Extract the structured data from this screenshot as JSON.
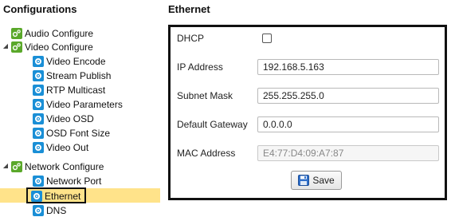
{
  "sidebar": {
    "title": "Configurations",
    "items": [
      {
        "label": "Audio Configure"
      },
      {
        "label": "Video Configure"
      },
      {
        "label": "Video Encode"
      },
      {
        "label": "Stream Publish"
      },
      {
        "label": "RTP Multicast"
      },
      {
        "label": "Video Parameters"
      },
      {
        "label": "Video OSD"
      },
      {
        "label": "OSD Font Size"
      },
      {
        "label": "Video Out"
      },
      {
        "label": "Network Configure"
      },
      {
        "label": "Network Port"
      },
      {
        "label": "Ethernet"
      },
      {
        "label": "DNS"
      }
    ]
  },
  "main": {
    "title": "Ethernet",
    "dhcp_label": "DHCP",
    "dhcp_checked": false,
    "ip_label": "IP Address",
    "ip_value": "192.168.5.163",
    "mask_label": "Subnet Mask",
    "mask_value": "255.255.255.0",
    "gateway_label": "Default Gateway",
    "gateway_value": "0.0.0.0",
    "mac_label": "MAC Address",
    "mac_value": "E4:77:D4:09:A7:87",
    "save_label": "Save"
  },
  "colors": {
    "selected_bg": "#ffe38a",
    "green_icon": "#5aa82a",
    "blue_icon": "#1a8fd6"
  }
}
